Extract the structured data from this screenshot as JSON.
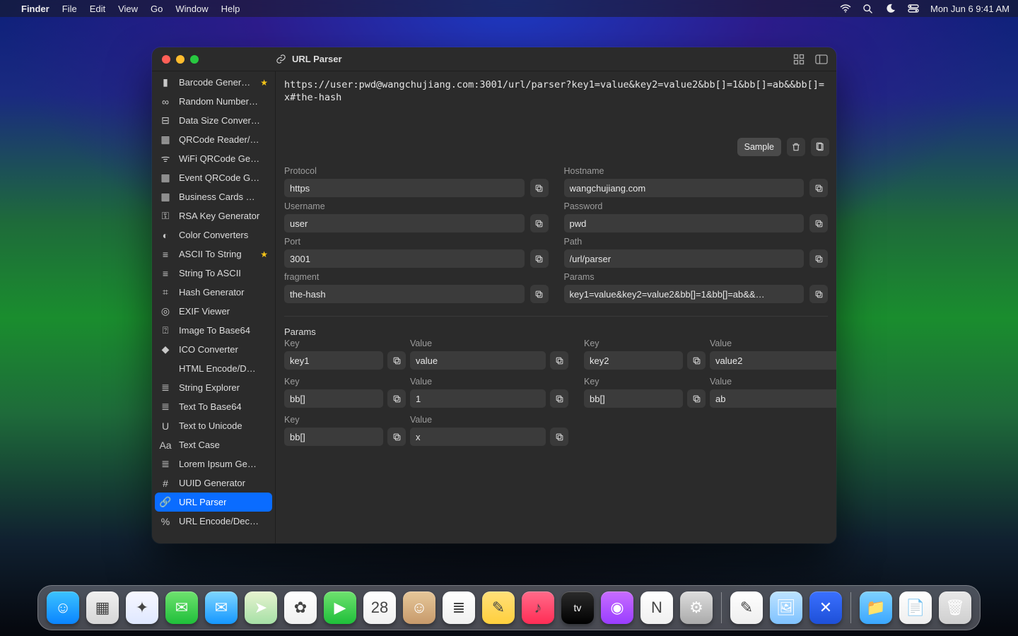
{
  "menubar": {
    "app": "Finder",
    "items": [
      "File",
      "Edit",
      "View",
      "Go",
      "Window",
      "Help"
    ],
    "clock": "Mon Jun 6  9:41 AM"
  },
  "window": {
    "title": "URL Parser",
    "toolbar": {
      "sample": "Sample"
    }
  },
  "sidebar": {
    "items": [
      {
        "label": "Barcode Gener…",
        "starred": true
      },
      {
        "label": "Random Number G…"
      },
      {
        "label": "Data Size Converter"
      },
      {
        "label": "QRCode Reader/Ge…"
      },
      {
        "label": "WiFi QRCode Gener…"
      },
      {
        "label": "Event QRCode Gen…"
      },
      {
        "label": "Business Cards QR…"
      },
      {
        "label": "RSA Key Generator"
      },
      {
        "label": "Color Converters"
      },
      {
        "label": "ASCII To String",
        "starred": true
      },
      {
        "label": "String To ASCII"
      },
      {
        "label": "Hash Generator"
      },
      {
        "label": "EXIF Viewer"
      },
      {
        "label": "Image To Base64"
      },
      {
        "label": "ICO Converter"
      },
      {
        "label": "HTML Encode/Dec…"
      },
      {
        "label": "String Explorer"
      },
      {
        "label": "Text To Base64"
      },
      {
        "label": "Text to Unicode"
      },
      {
        "label": "Text Case"
      },
      {
        "label": "Lorem Ipsum Gener…"
      },
      {
        "label": "UUID Generator"
      },
      {
        "label": "URL Parser",
        "active": true
      },
      {
        "label": "URL Encode/Decode"
      }
    ]
  },
  "url": "https://user:pwd@wangchujiang.com:3001/url/parser?key1=value&key2=value2&bb[]=1&bb[]=ab&&bb[]=x#the-hash",
  "fields": {
    "protocol": {
      "label": "Protocol",
      "value": "https"
    },
    "hostname": {
      "label": "Hostname",
      "value": "wangchujiang.com"
    },
    "username": {
      "label": "Username",
      "value": "user"
    },
    "password": {
      "label": "Password",
      "value": "pwd"
    },
    "port": {
      "label": "Port",
      "value": "3001"
    },
    "path": {
      "label": "Path",
      "value": "/url/parser"
    },
    "fragment": {
      "label": "fragment",
      "value": "the-hash"
    },
    "params": {
      "label": "Params",
      "value": "key1=value&key2=value2&bb[]=1&bb[]=ab&&…"
    }
  },
  "paramsSection": {
    "title": "Params",
    "keyLabel": "Key",
    "valueLabel": "Value",
    "pairs": [
      {
        "key": "key1",
        "value": "value"
      },
      {
        "key": "key2",
        "value": "value2"
      },
      {
        "key": "bb[]",
        "value": "1"
      },
      {
        "key": "bb[]",
        "value": "ab"
      },
      {
        "key": "bb[]",
        "value": "x"
      }
    ]
  },
  "dock": {
    "apps": [
      {
        "name": "finder",
        "bg": "linear-gradient(180deg,#3cc3ff,#0a84ff)",
        "glyph": "☺"
      },
      {
        "name": "launchpad",
        "bg": "linear-gradient(180deg,#f0f0f0,#d6d6d6)",
        "glyph": "▦"
      },
      {
        "name": "safari",
        "bg": "linear-gradient(180deg,#f7f7ff,#dfe8ff)",
        "glyph": "✦"
      },
      {
        "name": "messages",
        "bg": "linear-gradient(180deg,#6fe26f,#1fbf3a)",
        "glyph": "✉"
      },
      {
        "name": "mail",
        "bg": "linear-gradient(180deg,#7fd6ff,#1597ff)",
        "glyph": "✉"
      },
      {
        "name": "maps",
        "bg": "linear-gradient(180deg,#e7f3d0,#a6e0a6)",
        "glyph": "➤"
      },
      {
        "name": "photos",
        "bg": "linear-gradient(180deg,#fff,#f0f0f0)",
        "glyph": "✿"
      },
      {
        "name": "facetime",
        "bg": "linear-gradient(180deg,#6fe26f,#1fbf3a)",
        "glyph": "▶"
      },
      {
        "name": "calendar",
        "bg": "linear-gradient(180deg,#fff,#f0f0f0)",
        "glyph": "28"
      },
      {
        "name": "contacts",
        "bg": "linear-gradient(180deg,#e6c79a,#c79a6b)",
        "glyph": "☺"
      },
      {
        "name": "reminders",
        "bg": "linear-gradient(180deg,#fff,#f0f0f0)",
        "glyph": "≣"
      },
      {
        "name": "notes",
        "bg": "linear-gradient(180deg,#ffe07a,#ffcf3d)",
        "glyph": "✎"
      },
      {
        "name": "music",
        "bg": "linear-gradient(180deg,#ff6b8a,#ff2d55)",
        "glyph": "♪"
      },
      {
        "name": "tv",
        "bg": "linear-gradient(180deg,#2b2b2b,#000)",
        "glyph": "tv"
      },
      {
        "name": "podcasts",
        "bg": "linear-gradient(180deg,#c86dff,#9a3dff)",
        "glyph": "◉"
      },
      {
        "name": "news",
        "bg": "linear-gradient(180deg,#fff,#f0f0f0)",
        "glyph": "N"
      },
      {
        "name": "settings",
        "bg": "linear-gradient(180deg,#ddd,#aaa)",
        "glyph": "⚙"
      }
    ],
    "apps2": [
      {
        "name": "textedit",
        "bg": "linear-gradient(180deg,#fff,#eee)",
        "glyph": "✎"
      },
      {
        "name": "preview",
        "bg": "linear-gradient(180deg,#bde3ff,#7fc2ff)",
        "glyph": "🖼"
      },
      {
        "name": "utility",
        "bg": "linear-gradient(180deg,#3a70ff,#1e50d8)",
        "glyph": "✕"
      }
    ],
    "apps3": [
      {
        "name": "folder",
        "bg": "linear-gradient(180deg,#7fd1ff,#3aa7ff)",
        "glyph": "📁"
      },
      {
        "name": "pages",
        "bg": "linear-gradient(180deg,#fff,#eee)",
        "glyph": "📄"
      },
      {
        "name": "trash",
        "bg": "linear-gradient(180deg,#e8e8e8,#cfcfcf)",
        "glyph": "🗑"
      }
    ]
  }
}
